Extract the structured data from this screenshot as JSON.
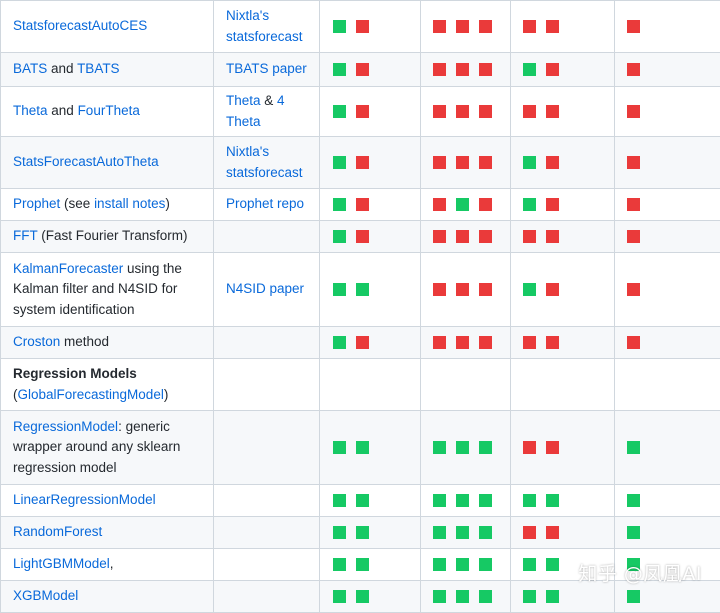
{
  "colors": {
    "green": "#16c964",
    "red": "#ea3a3a",
    "link": "#0969da"
  },
  "watermark": "知乎 @凤凰AI",
  "rows": [
    {
      "h": 52,
      "model": [
        {
          "t": "StatsforecastAutoCES",
          "link": true
        }
      ],
      "source": [
        {
          "t": "Nixtla's statsforecast",
          "link": true
        }
      ],
      "marks": [
        [
          "g",
          "r"
        ],
        [
          "r",
          "r",
          "r"
        ],
        [
          "r",
          "r"
        ],
        [
          "r"
        ]
      ]
    },
    {
      "h": 34,
      "model": [
        {
          "t": "BATS",
          "link": true
        },
        {
          "t": " and "
        },
        {
          "t": "TBATS",
          "link": true
        }
      ],
      "source": [
        {
          "t": "TBATS paper",
          "link": true
        }
      ],
      "marks": [
        [
          "g",
          "r"
        ],
        [
          "r",
          "r",
          "r"
        ],
        [
          "g",
          "r"
        ],
        [
          "r"
        ]
      ]
    },
    {
      "h": 50,
      "model": [
        {
          "t": "Theta",
          "link": true
        },
        {
          "t": " and "
        },
        {
          "t": "FourTheta",
          "link": true
        }
      ],
      "source": [
        {
          "t": "Theta",
          "link": true
        },
        {
          "t": " & "
        },
        {
          "t": "4 Theta",
          "link": true
        }
      ],
      "marks": [
        [
          "g",
          "r"
        ],
        [
          "r",
          "r",
          "r"
        ],
        [
          "r",
          "r"
        ],
        [
          "r"
        ]
      ]
    },
    {
      "h": 52,
      "model": [
        {
          "t": "StatsForecastAutoTheta",
          "link": true
        }
      ],
      "source": [
        {
          "t": "Nixtla's statsforecast",
          "link": true
        }
      ],
      "marks": [
        [
          "g",
          "r"
        ],
        [
          "r",
          "r",
          "r"
        ],
        [
          "g",
          "r"
        ],
        [
          "r"
        ]
      ]
    },
    {
      "h": 32,
      "model": [
        {
          "t": "Prophet",
          "link": true
        },
        {
          "t": " (see "
        },
        {
          "t": "install notes",
          "link": true
        },
        {
          "t": ")"
        }
      ],
      "source": [
        {
          "t": "Prophet repo",
          "link": true
        }
      ],
      "marks": [
        [
          "g",
          "r"
        ],
        [
          "r",
          "g",
          "r"
        ],
        [
          "g",
          "r"
        ],
        [
          "r"
        ]
      ]
    },
    {
      "h": 32,
      "model": [
        {
          "t": "FFT",
          "link": true
        },
        {
          "t": " (Fast Fourier Transform)"
        }
      ],
      "source": [],
      "marks": [
        [
          "g",
          "r"
        ],
        [
          "r",
          "r",
          "r"
        ],
        [
          "r",
          "r"
        ],
        [
          "r"
        ]
      ]
    },
    {
      "h": 74,
      "model": [
        {
          "t": "KalmanForecaster",
          "link": true
        },
        {
          "t": " using the Kalman filter and N4SID for system identification"
        }
      ],
      "source": [
        {
          "t": "N4SID paper",
          "link": true
        }
      ],
      "marks": [
        [
          "g",
          "g"
        ],
        [
          "r",
          "r",
          "r"
        ],
        [
          "g",
          "r"
        ],
        [
          "r"
        ]
      ]
    },
    {
      "h": 32,
      "model": [
        {
          "t": "Croston",
          "link": true
        },
        {
          "t": " method"
        }
      ],
      "source": [],
      "marks": [
        [
          "g",
          "r"
        ],
        [
          "r",
          "r",
          "r"
        ],
        [
          "r",
          "r"
        ],
        [
          "r"
        ]
      ]
    },
    {
      "h": 52,
      "model": [
        {
          "t": "Regression Models",
          "bold": true
        },
        {
          "t": " ("
        },
        {
          "t": "GlobalForecastingModel",
          "link": true
        },
        {
          "t": ")"
        }
      ],
      "source": [],
      "marks": [
        [],
        [],
        [],
        []
      ]
    },
    {
      "h": 74,
      "model": [
        {
          "t": "RegressionModel",
          "link": true
        },
        {
          "t": ": generic wrapper around any sklearn regression model"
        }
      ],
      "source": [],
      "marks": [
        [
          "g",
          "g"
        ],
        [
          "g",
          "g",
          "g"
        ],
        [
          "r",
          "r"
        ],
        [
          "g"
        ]
      ]
    },
    {
      "h": 32,
      "model": [
        {
          "t": "LinearRegressionModel",
          "link": true
        }
      ],
      "source": [],
      "marks": [
        [
          "g",
          "g"
        ],
        [
          "g",
          "g",
          "g"
        ],
        [
          "g",
          "g"
        ],
        [
          "g"
        ]
      ]
    },
    {
      "h": 32,
      "model": [
        {
          "t": "RandomForest",
          "link": true
        }
      ],
      "source": [],
      "marks": [
        [
          "g",
          "g"
        ],
        [
          "g",
          "g",
          "g"
        ],
        [
          "r",
          "r"
        ],
        [
          "g"
        ]
      ]
    },
    {
      "h": 32,
      "model": [
        {
          "t": "LightGBMModel",
          "link": true
        },
        {
          "t": ","
        }
      ],
      "source": [],
      "marks": [
        [
          "g",
          "g"
        ],
        [
          "g",
          "g",
          "g"
        ],
        [
          "g",
          "g"
        ],
        [
          "g"
        ]
      ]
    },
    {
      "h": 32,
      "model": [
        {
          "t": "XGBModel",
          "link": true
        }
      ],
      "source": [],
      "marks": [
        [
          "g",
          "g"
        ],
        [
          "g",
          "g",
          "g"
        ],
        [
          "g",
          "g"
        ],
        [
          "g"
        ]
      ]
    }
  ]
}
